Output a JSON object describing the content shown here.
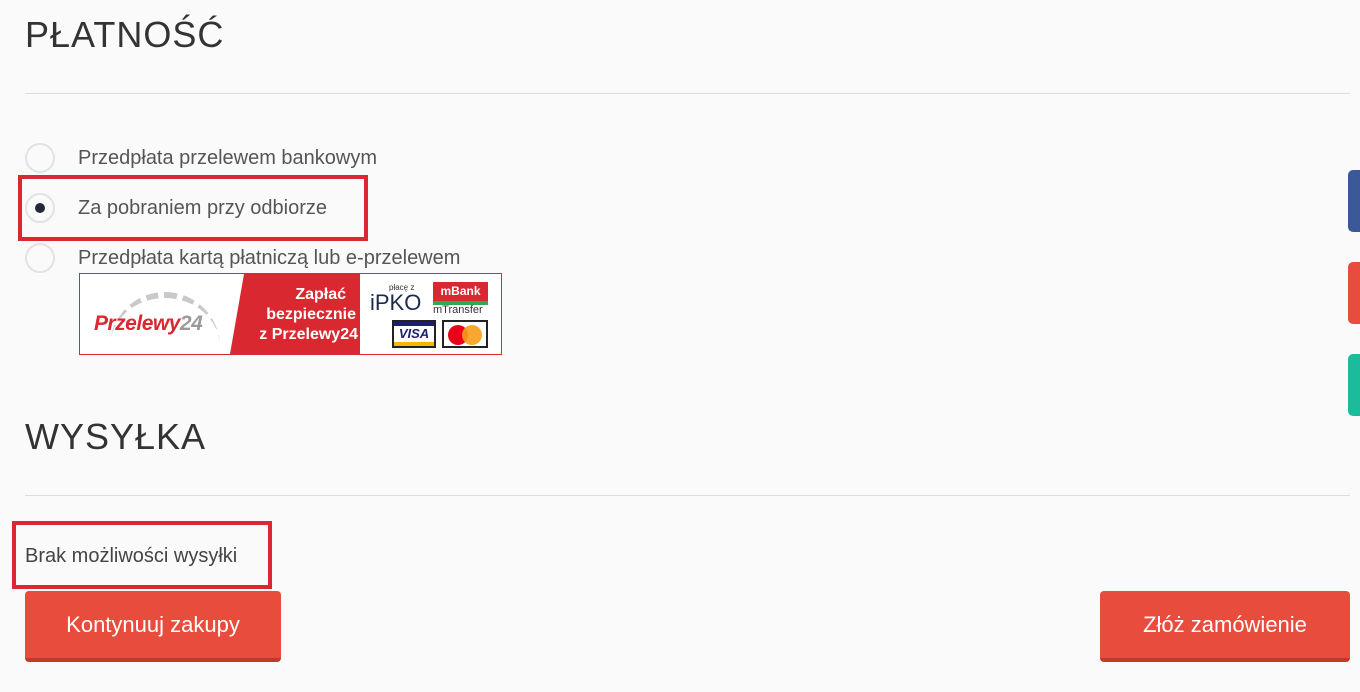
{
  "payment": {
    "title": "PŁATNOŚĆ",
    "options": [
      {
        "label": "Przedpłata przelewem bankowym",
        "checked": false
      },
      {
        "label": "Za pobraniem przy odbiorze",
        "checked": true
      },
      {
        "label": "Przedpłata kartą płatniczą lub e-przelewem",
        "checked": false
      }
    ],
    "banner": {
      "logo_text": "Przelewy",
      "logo_number": "24",
      "slogan_line1": "Zapłać",
      "slogan_line2": "bezpiecznie",
      "slogan_line3": "z Przelewy24",
      "ipko_small": "płacę z",
      "ipko": "iPKO",
      "mbank": "mBank",
      "mtransfer": "mTransfer",
      "visa": "VISA"
    }
  },
  "shipping": {
    "title": "WYSYŁKA",
    "message": "Brak możliwości wysyłki"
  },
  "buttons": {
    "continue": "Kontynuuj zakupy",
    "order": "Złóż zamówienie"
  },
  "colors": {
    "accent": "#e74c3c",
    "highlight": "#d9282f",
    "side_tabs": [
      "#3b5998",
      "#e74c3c",
      "#1abc9c"
    ]
  }
}
